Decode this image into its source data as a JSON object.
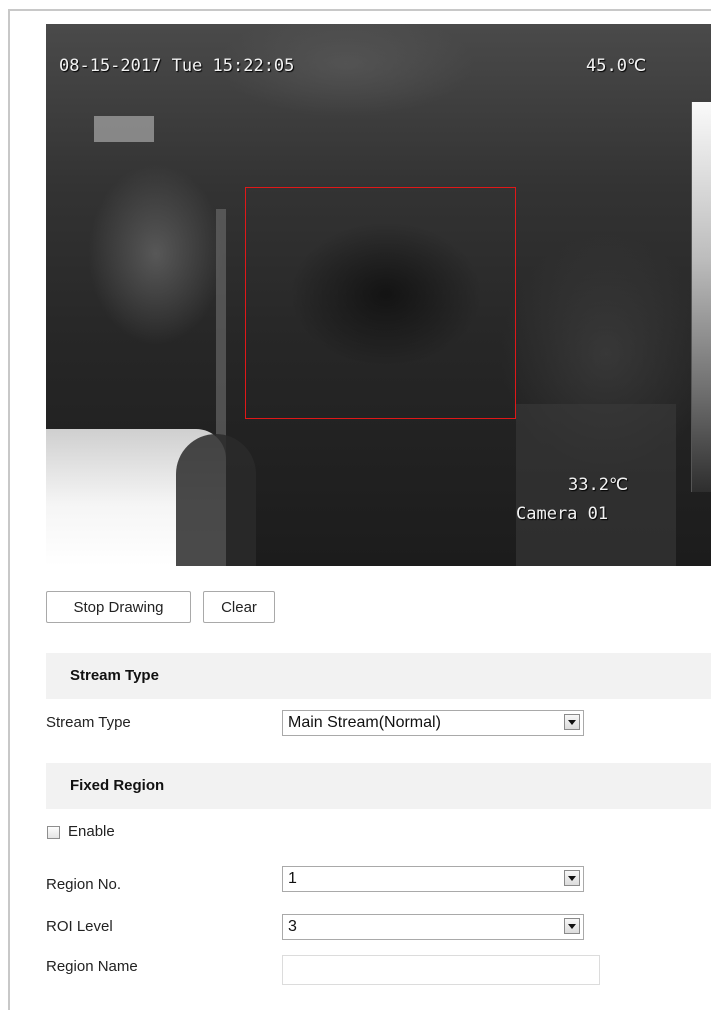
{
  "video": {
    "datetime": "08-15-2017 Tue 15:22:05",
    "max_temp": "45.0℃",
    "min_temp": "33.2℃",
    "camera_name": "Camera 01"
  },
  "buttons": {
    "stop_drawing": "Stop Drawing",
    "clear": "Clear"
  },
  "stream_type_section": {
    "title": "Stream Type",
    "label": "Stream Type",
    "value": "Main Stream(Normal)"
  },
  "fixed_region_section": {
    "title": "Fixed Region",
    "enable_label": "Enable",
    "enable_checked": false,
    "region_no_label": "Region No.",
    "region_no_value": "1",
    "roi_level_label": "ROI Level",
    "roi_level_value": "3",
    "region_name_label": "Region Name",
    "region_name_value": ""
  },
  "icons": {
    "dropdown": "chevron-down-icon"
  },
  "colors": {
    "roi_rectangle": "#e01818",
    "section_header_bg": "#f2f2f2"
  }
}
